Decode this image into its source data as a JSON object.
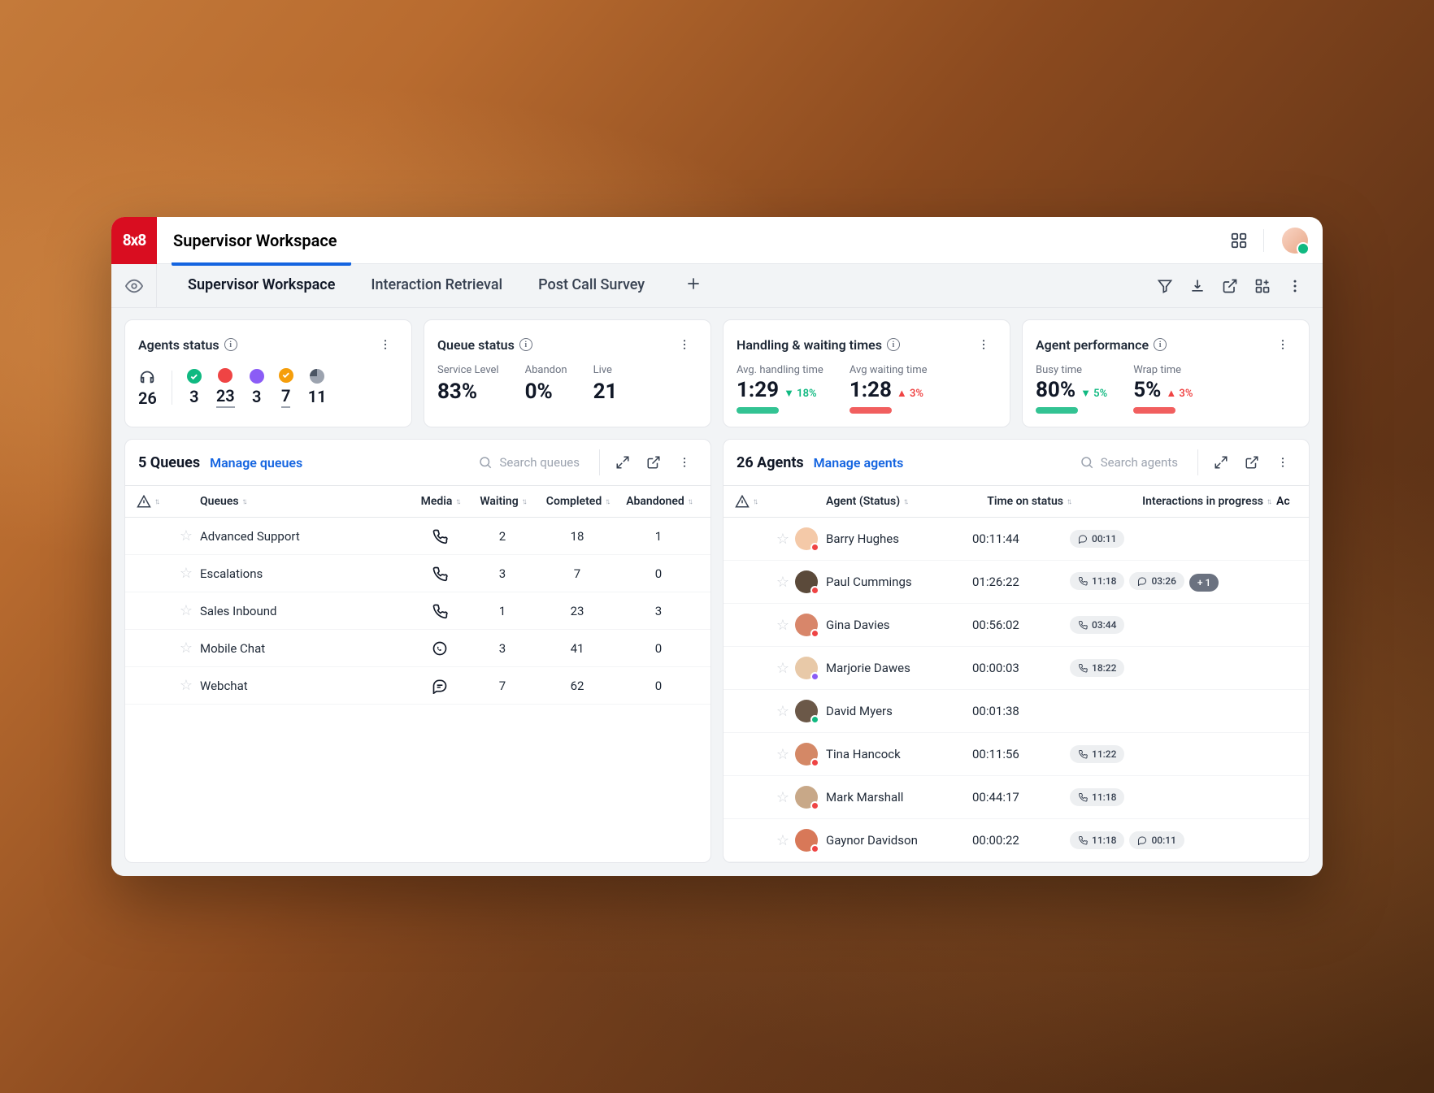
{
  "brand": "8x8",
  "header": {
    "title": "Supervisor Workspace"
  },
  "tabs": {
    "items": [
      {
        "label": "Supervisor Workspace",
        "active": true
      },
      {
        "label": "Interaction Retrieval",
        "active": false
      },
      {
        "label": "Post Call Survey",
        "active": false
      }
    ]
  },
  "cards": {
    "agents_status": {
      "title": "Agents status",
      "total": "26",
      "groups": [
        {
          "color": "green",
          "value": "3"
        },
        {
          "color": "red",
          "value": "23",
          "underline": true
        },
        {
          "color": "purple",
          "value": "3"
        },
        {
          "color": "yellow",
          "value": "7",
          "underline": true
        },
        {
          "color": "gray",
          "value": "11"
        }
      ]
    },
    "queue_status": {
      "title": "Queue status",
      "metrics": [
        {
          "label": "Service Level",
          "value": "83%"
        },
        {
          "label": "Abandon",
          "value": "0%"
        },
        {
          "label": "Live",
          "value": "21"
        }
      ]
    },
    "handling": {
      "title": "Handling & waiting times",
      "metrics": [
        {
          "label": "Avg. handling time",
          "value": "1:29",
          "trend": {
            "dir": "down",
            "text": "18%"
          },
          "spark": "green"
        },
        {
          "label": "Avg waiting time",
          "value": "1:28",
          "trend": {
            "dir": "up",
            "text": "3%"
          },
          "spark": "red"
        }
      ]
    },
    "performance": {
      "title": "Agent performance",
      "metrics": [
        {
          "label": "Busy time",
          "value": "80%",
          "trend": {
            "dir": "down",
            "text": "5%"
          },
          "spark": "green"
        },
        {
          "label": "Wrap time",
          "value": "5%",
          "trend": {
            "dir": "up",
            "text": "3%"
          },
          "spark": "red"
        }
      ]
    }
  },
  "queues_panel": {
    "title": "5 Queues",
    "manage": "Manage queues",
    "search_placeholder": "Search queues",
    "columns": {
      "queues": "Queues",
      "media": "Media",
      "waiting": "Waiting",
      "completed": "Completed",
      "abandoned": "Abandoned"
    },
    "rows": [
      {
        "name": "Advanced Support",
        "media": "phone",
        "waiting": "2",
        "completed": "18",
        "abandoned": "1"
      },
      {
        "name": "Escalations",
        "media": "phone",
        "waiting": "3",
        "completed": "7",
        "abandoned": "0"
      },
      {
        "name": "Sales Inbound",
        "media": "phone",
        "waiting": "1",
        "completed": "23",
        "abandoned": "3"
      },
      {
        "name": "Mobile Chat",
        "media": "whatsapp",
        "waiting": "3",
        "completed": "41",
        "abandoned": "0"
      },
      {
        "name": "Webchat",
        "media": "chat",
        "waiting": "7",
        "completed": "62",
        "abandoned": "0"
      }
    ]
  },
  "agents_panel": {
    "title": "26 Agents",
    "manage": "Manage agents",
    "search_placeholder": "Search agents",
    "columns": {
      "agent": "Agent (Status)",
      "time": "Time on status",
      "interactions": "Interactions in progress",
      "actions": "Ac"
    },
    "rows": [
      {
        "name": "Barry Hughes",
        "time": "00:11:44",
        "status_color": "#ef4444",
        "avatar_bg": "#f4c9a8",
        "pills": [
          {
            "icon": "chat",
            "text": "00:11"
          }
        ]
      },
      {
        "name": "Paul Cummings",
        "time": "01:26:22",
        "status_color": "#ef4444",
        "avatar_bg": "#5b4a3a",
        "pills": [
          {
            "icon": "phone",
            "text": "11:18"
          },
          {
            "icon": "chat",
            "text": "03:26"
          },
          {
            "icon": "plus",
            "text": "+ 1",
            "dark": true
          }
        ]
      },
      {
        "name": "Gina Davies",
        "time": "00:56:02",
        "status_color": "#ef4444",
        "avatar_bg": "#d8866a",
        "pills": [
          {
            "icon": "phone",
            "text": "03:44"
          }
        ]
      },
      {
        "name": "Marjorie Dawes",
        "time": "00:00:03",
        "status_color": "#8b5cf6",
        "avatar_bg": "#e8c9a8",
        "pills": [
          {
            "icon": "phone",
            "text": "18:22"
          }
        ]
      },
      {
        "name": "David Myers",
        "time": "00:01:38",
        "status_color": "#10b981",
        "avatar_bg": "#6b5848",
        "pills": []
      },
      {
        "name": "Tina Hancock",
        "time": "00:11:56",
        "status_color": "#ef4444",
        "avatar_bg": "#d48866",
        "pills": [
          {
            "icon": "phone",
            "text": "11:22"
          }
        ]
      },
      {
        "name": "Mark Marshall",
        "time": "00:44:17",
        "status_color": "#ef4444",
        "avatar_bg": "#c8a888",
        "pills": [
          {
            "icon": "phone",
            "text": "11:18"
          }
        ]
      },
      {
        "name": "Gaynor Davidson",
        "time": "00:00:22",
        "status_color": "#ef4444",
        "avatar_bg": "#d87858",
        "pills": [
          {
            "icon": "phone",
            "text": "11:18"
          },
          {
            "icon": "chat",
            "text": "00:11"
          }
        ]
      }
    ]
  }
}
